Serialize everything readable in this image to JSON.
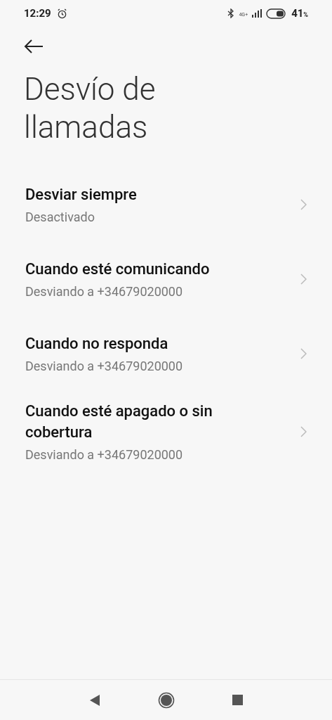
{
  "status_bar": {
    "time": "12:29",
    "network": "4G+",
    "battery": "41",
    "battery_unit": "%"
  },
  "title": "Desvío de llamadas",
  "items": [
    {
      "title": "Desviar siempre",
      "subtitle": "Desactivado"
    },
    {
      "title": "Cuando esté comunicando",
      "subtitle": "Desviando a +34679020000"
    },
    {
      "title": "Cuando no responda",
      "subtitle": "Desviando a +34679020000"
    },
    {
      "title": "Cuando esté apagado o sin cobertura",
      "subtitle": "Desviando a +34679020000"
    }
  ]
}
